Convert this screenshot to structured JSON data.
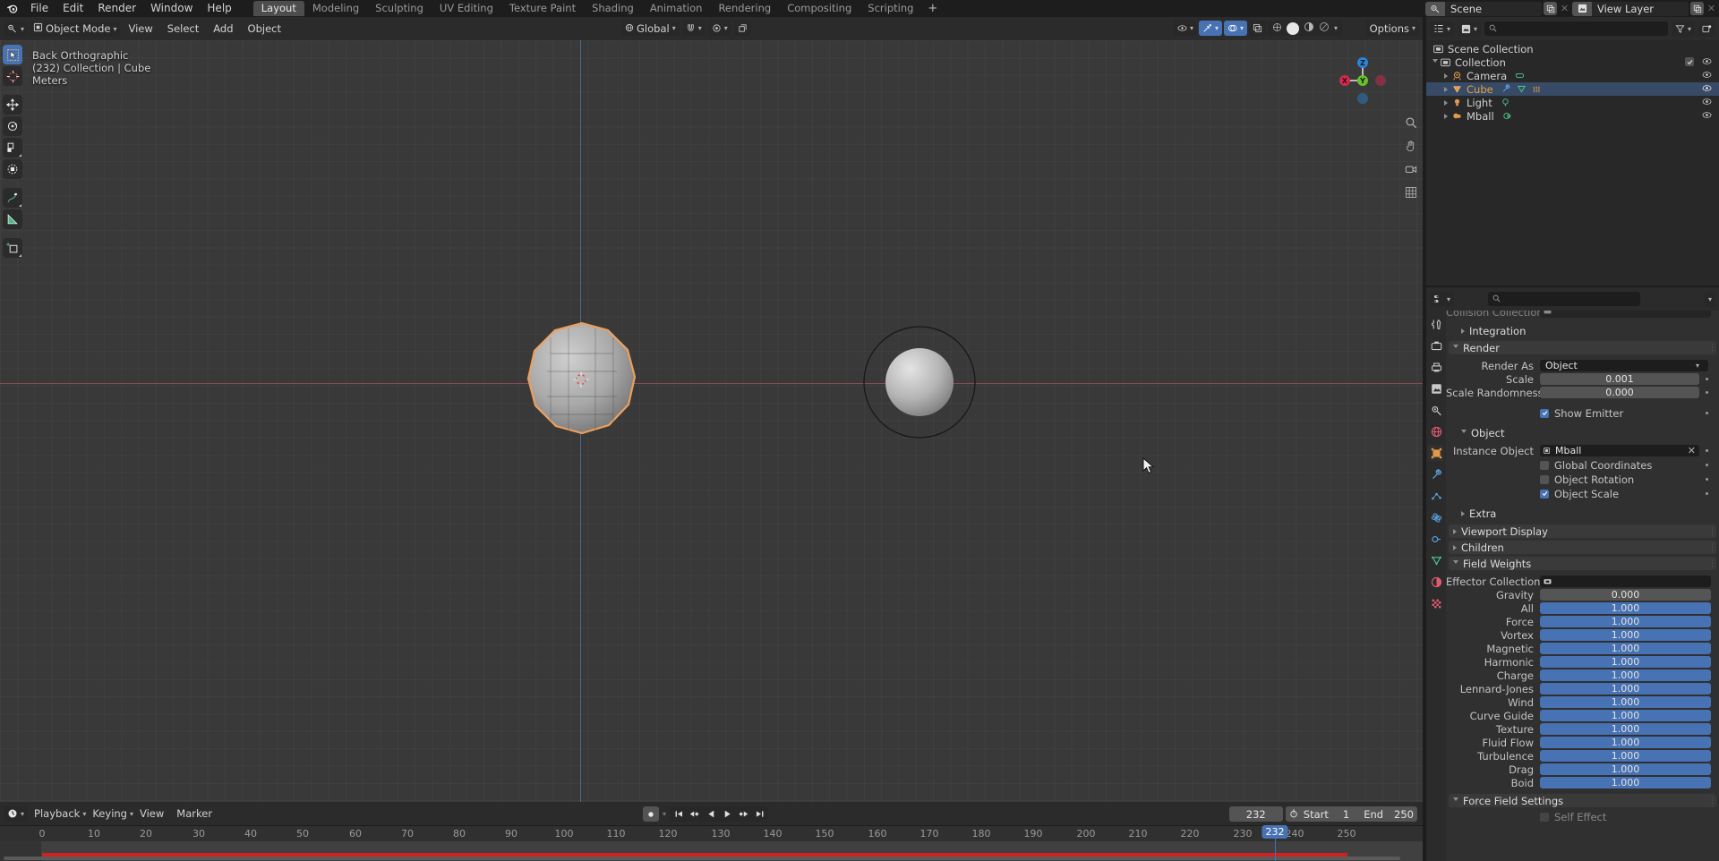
{
  "app": {
    "name": "Blender",
    "logo_icon": "blender-logo-icon"
  },
  "topbar": {
    "menus": [
      "File",
      "Edit",
      "Render",
      "Window",
      "Help"
    ],
    "workspace_tabs": [
      {
        "label": "Layout",
        "active": true
      },
      {
        "label": "Modeling",
        "active": false
      },
      {
        "label": "Sculpting",
        "active": false
      },
      {
        "label": "UV Editing",
        "active": false
      },
      {
        "label": "Texture Paint",
        "active": false
      },
      {
        "label": "Shading",
        "active": false
      },
      {
        "label": "Animation",
        "active": false
      },
      {
        "label": "Rendering",
        "active": false
      },
      {
        "label": "Compositing",
        "active": false
      },
      {
        "label": "Scripting",
        "active": false
      }
    ],
    "add_workspace_label": "+",
    "scene": {
      "label": "Scene",
      "icon": "scene-icon",
      "new_icon": "duplicate-icon",
      "unlink_icon": "x-icon"
    },
    "view_layer": {
      "label": "View Layer",
      "icon": "view-layer-icon",
      "new_icon": "duplicate-icon",
      "unlink_icon": "x-icon"
    }
  },
  "viewport": {
    "header": {
      "mode": "Object Mode",
      "mode_icon": "object-mode-icon",
      "editor_type_icon": "editor-type-icon",
      "menus": [
        "View",
        "Select",
        "Add",
        "Object"
      ],
      "transform_orientation": "Global",
      "snap_icon": "magnet-icon",
      "proportional_icon": "proportional-edit-icon",
      "options_label": "Options",
      "visibility_icon": "show-hide-icon",
      "gizmo_icon": "gizmo-icon",
      "overlays_icon": "overlays-icon",
      "xray_icon": "xray-icon",
      "shading_modes": [
        "wireframe",
        "solid",
        "material-preview",
        "rendered"
      ],
      "shading_active": "solid"
    },
    "overlay_text": {
      "view_name": "Back Orthographic",
      "collection_line": "(232) Collection | Cube",
      "units": "Meters"
    },
    "toolbar": [
      {
        "name": "tweak-tool",
        "active": true
      },
      {
        "name": "cursor-tool",
        "active": false
      },
      {
        "name": "move-tool",
        "active": false
      },
      {
        "name": "rotate-tool",
        "active": false
      },
      {
        "name": "scale-tool",
        "active": false
      },
      {
        "name": "transform-tool",
        "active": false
      },
      {
        "name": "annotate-tool",
        "active": false
      },
      {
        "name": "measure-tool",
        "active": false
      },
      {
        "name": "add-cube-tool",
        "active": false
      }
    ],
    "gizmo_axes": [
      "X",
      "Y",
      "Z"
    ],
    "nav_icons": [
      "zoom-icon",
      "pan-icon",
      "camera-icon",
      "grid-icon"
    ]
  },
  "timeline": {
    "editor_icon": "timeline-editor-icon",
    "menus": [
      "Playback",
      "Keying",
      "View",
      "Marker"
    ],
    "auto_key_icon": "record-icon",
    "transport": [
      "jump-to-start-icon",
      "jump-prev-keyframe-icon",
      "play-reverse-icon",
      "play-icon",
      "jump-next-keyframe-icon",
      "jump-to-end-icon"
    ],
    "current_frame": "232",
    "current_frame_badge": "232",
    "timer_icon": "stopwatch-icon",
    "start_label": "Start",
    "start_value": "1",
    "end_label": "End",
    "end_value": "250",
    "ticks": [
      "0",
      "10",
      "20",
      "30",
      "40",
      "50",
      "60",
      "70",
      "80",
      "90",
      "100",
      "110",
      "120",
      "130",
      "140",
      "150",
      "160",
      "170",
      "180",
      "190",
      "200",
      "210",
      "220",
      "230",
      "240",
      "250"
    ],
    "range_color": "#cf2121",
    "playhead_color": "#4772b3"
  },
  "outliner": {
    "display_mode_icon": "outliner-display-mode-icon",
    "filter_icon": "filter-icon",
    "new_collection_icon": "new-collection-icon",
    "search_placeholder": "",
    "search_icon": "search-icon",
    "rows": [
      {
        "label": "Scene Collection",
        "icon": "scene-collection-icon",
        "depth": 0,
        "selected": false,
        "expandable": false,
        "eye": false,
        "checkbox": false
      },
      {
        "label": "Collection",
        "icon": "collection-icon",
        "depth": 1,
        "selected": false,
        "expandable": true,
        "expanded": true,
        "eye": true,
        "checkbox": true
      },
      {
        "label": "Camera",
        "icon": "camera-object-icon",
        "depth": 2,
        "selected": false,
        "expandable": true,
        "expanded": false,
        "eye": true,
        "checkbox": false,
        "data_icons": [
          "camera-data-icon"
        ]
      },
      {
        "label": "Cube",
        "icon": "mesh-object-icon",
        "depth": 2,
        "selected": true,
        "expandable": true,
        "expanded": false,
        "eye": true,
        "checkbox": false,
        "data_icons": [
          "modifier-icon",
          "mesh-data-icon",
          "particles-icon"
        ]
      },
      {
        "label": "Light",
        "icon": "light-object-icon",
        "depth": 2,
        "selected": false,
        "expandable": true,
        "expanded": false,
        "eye": true,
        "checkbox": false,
        "data_icons": [
          "light-data-icon"
        ]
      },
      {
        "label": "Mball",
        "icon": "meta-object-icon",
        "depth": 2,
        "selected": false,
        "expandable": true,
        "expanded": false,
        "eye": true,
        "checkbox": false,
        "data_icons": [
          "meta-data-icon"
        ]
      }
    ]
  },
  "properties": {
    "editor_icon": "properties-editor-icon",
    "search_placeholder": "",
    "search_icon": "search-icon",
    "tabs": [
      {
        "name": "tool-tab",
        "active": false
      },
      {
        "name": "render-tab",
        "active": false
      },
      {
        "name": "output-tab",
        "active": false
      },
      {
        "name": "view-layer-tab",
        "active": false
      },
      {
        "name": "scene-tab",
        "active": false
      },
      {
        "name": "world-tab",
        "active": false
      },
      {
        "name": "object-tab",
        "active": true
      },
      {
        "name": "modifier-tab",
        "active": false
      },
      {
        "name": "particles-tab",
        "active": false
      },
      {
        "name": "physics-tab",
        "active": false
      },
      {
        "name": "constraints-tab",
        "active": false
      },
      {
        "name": "object-data-tab",
        "active": false
      },
      {
        "name": "material-tab",
        "active": false
      },
      {
        "name": "texture-tab",
        "active": false
      }
    ],
    "clipped_row": {
      "label": "Collision Collection",
      "value": "",
      "icon": "collection-icon"
    },
    "panels": [
      {
        "type": "collapsed-sub",
        "label": "Integration"
      },
      {
        "type": "open",
        "label": "Render"
      }
    ],
    "render": {
      "render_as_label": "Render As",
      "render_as_value": "Object",
      "scale_label": "Scale",
      "scale_value": "0.001",
      "scale_randomness_label": "Scale Randomness",
      "scale_randomness_value": "0.000",
      "show_emitter_label": "Show Emitter",
      "show_emitter_checked": true
    },
    "object_panel": {
      "title": "Object",
      "instance_object_label": "Instance Object",
      "instance_object_value": "Mball",
      "instance_object_icon": "object-icon",
      "clear_icon": "x-icon",
      "checkboxes": [
        {
          "label": "Global Coordinates",
          "checked": false
        },
        {
          "label": "Object Rotation",
          "checked": false
        },
        {
          "label": "Object Scale",
          "checked": true
        }
      ]
    },
    "extra_label": "Extra",
    "viewport_display_label": "Viewport Display",
    "children_label": "Children",
    "field_weights": {
      "title": "Field Weights",
      "effector_collection_label": "Effector Collection",
      "effector_collection_value": "",
      "effector_collection_icon": "collection-icon",
      "rows": [
        {
          "label": "Gravity",
          "value": "0.000",
          "style": "grey",
          "fill": 0
        },
        {
          "label": "All",
          "value": "1.000",
          "style": "blue",
          "fill": 100
        },
        {
          "label": "Force",
          "value": "1.000",
          "style": "blue",
          "fill": 100
        },
        {
          "label": "Vortex",
          "value": "1.000",
          "style": "blue",
          "fill": 100
        },
        {
          "label": "Magnetic",
          "value": "1.000",
          "style": "blue",
          "fill": 100
        },
        {
          "label": "Harmonic",
          "value": "1.000",
          "style": "blue",
          "fill": 100
        },
        {
          "label": "Charge",
          "value": "1.000",
          "style": "blue",
          "fill": 100
        },
        {
          "label": "Lennard-Jones",
          "value": "1.000",
          "style": "blue",
          "fill": 100
        },
        {
          "label": "Wind",
          "value": "1.000",
          "style": "blue",
          "fill": 100
        },
        {
          "label": "Curve Guide",
          "value": "1.000",
          "style": "blue",
          "fill": 100
        },
        {
          "label": "Texture",
          "value": "1.000",
          "style": "blue",
          "fill": 100
        },
        {
          "label": "Fluid Flow",
          "value": "1.000",
          "style": "blue",
          "fill": 100
        },
        {
          "label": "Turbulence",
          "value": "1.000",
          "style": "blue",
          "fill": 100
        },
        {
          "label": "Drag",
          "value": "1.000",
          "style": "blue",
          "fill": 100
        },
        {
          "label": "Boid",
          "value": "1.000",
          "style": "blue",
          "fill": 100
        }
      ]
    },
    "force_field_settings": {
      "title": "Force Field Settings",
      "self_effect_label": "Self Effect",
      "self_effect_checked": false
    }
  },
  "colors": {
    "accent_blue": "#4772b3",
    "selected_outline": "#ed9e5c",
    "red_axis": "#9c4a55",
    "blue_axis": "#4a6e9c",
    "panel_bg": "#303030",
    "header_bg": "#2b2b2b"
  }
}
